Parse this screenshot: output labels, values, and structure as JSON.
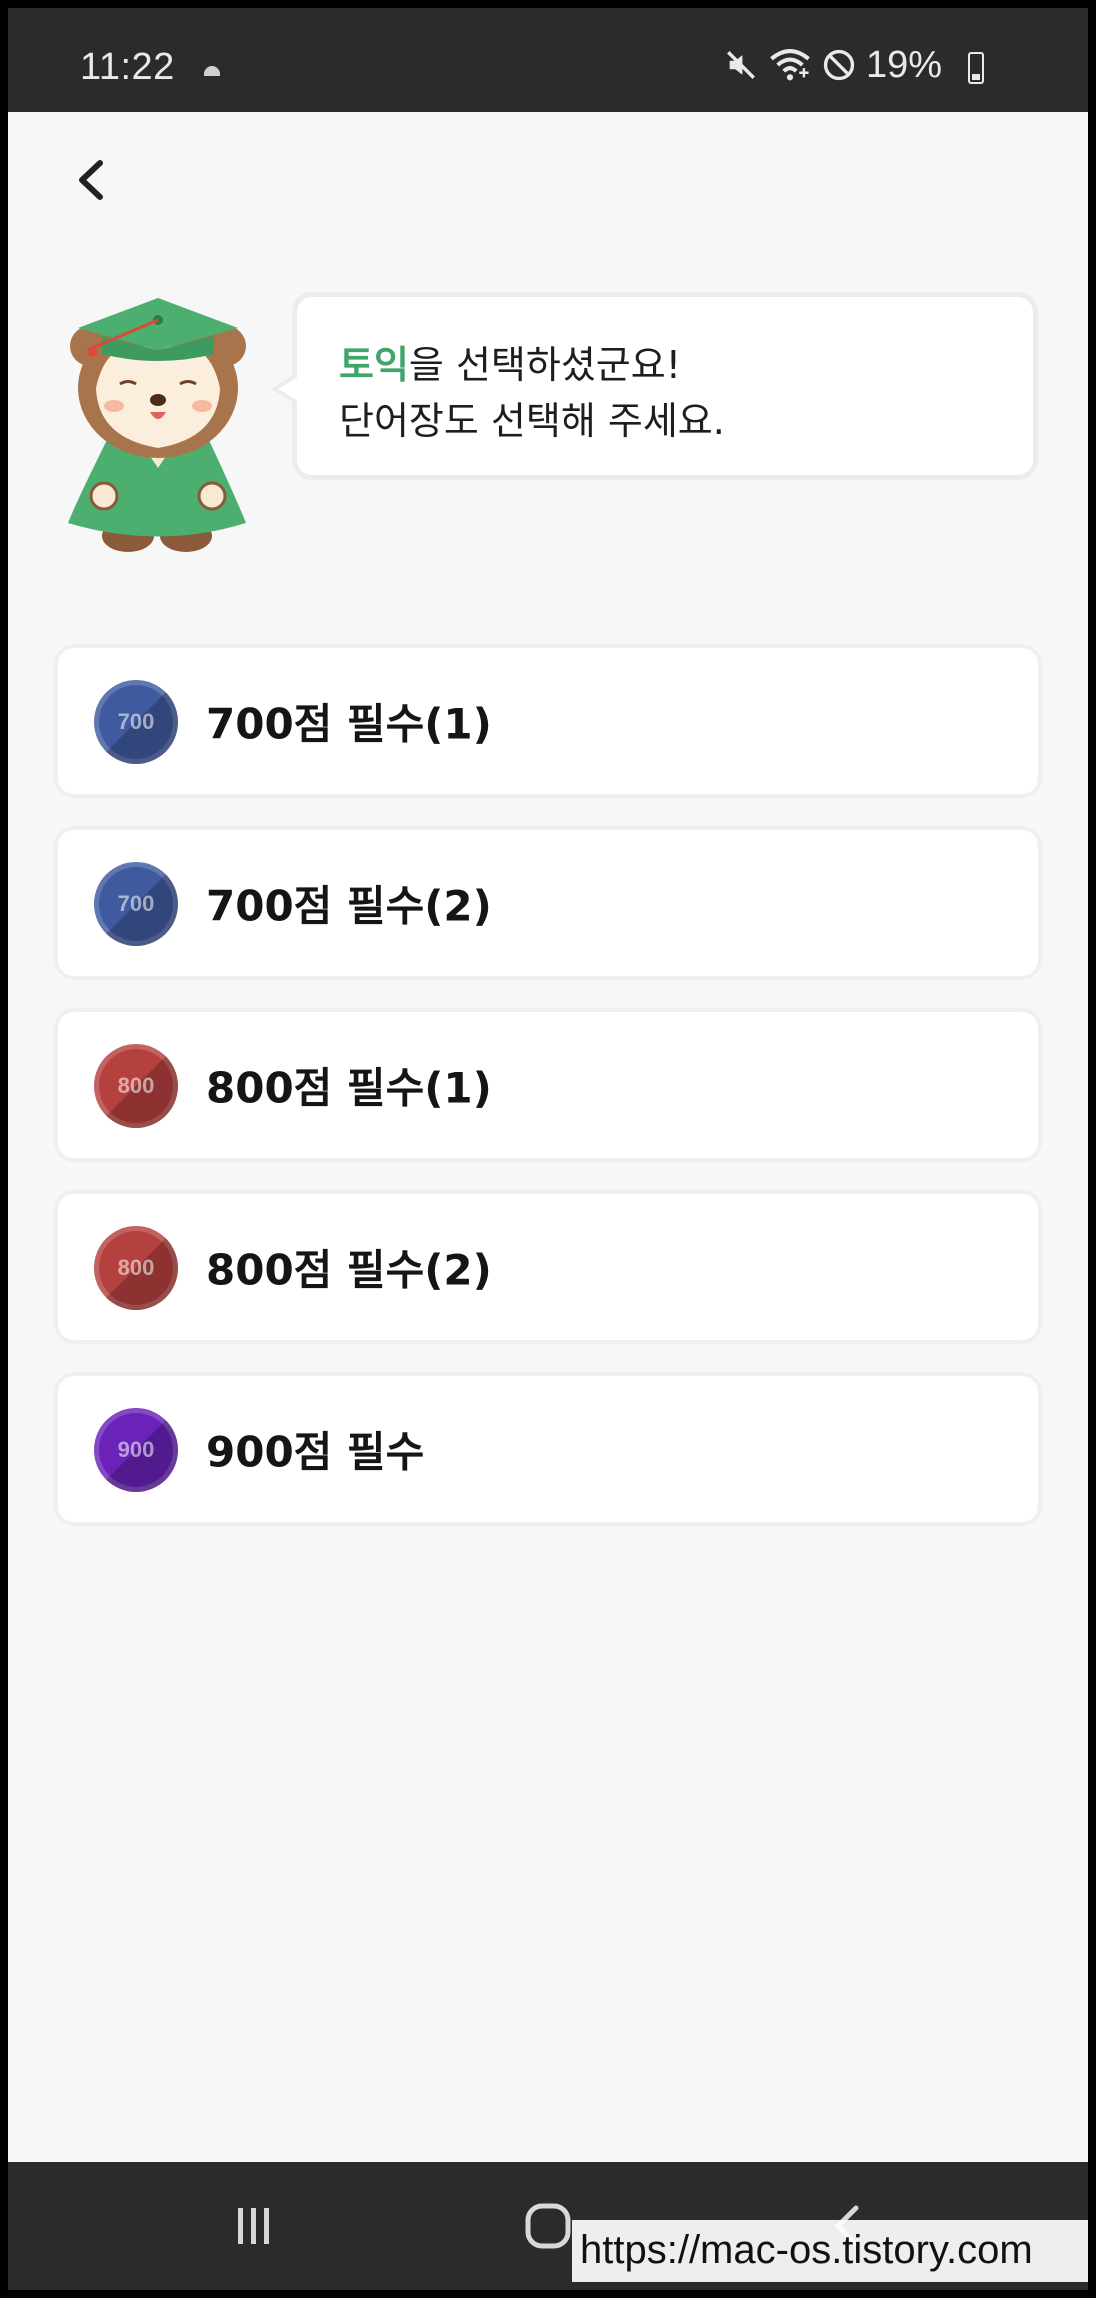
{
  "status_bar": {
    "time": "11:22",
    "battery": "19%",
    "icons": [
      "mute-icon",
      "wifi-icon",
      "do-not-disturb-icon",
      "battery-icon"
    ]
  },
  "header": {
    "back_icon": "chevron-left-icon"
  },
  "speech_bubble": {
    "highlight": "토익",
    "line1_rest": "을 선택하셨군요!",
    "line2": "단어장도 선택해 주세요.",
    "highlight_color": "#3fa56b"
  },
  "wordbooks": [
    {
      "badge": "700",
      "label": "700점 필수(1)",
      "color": "#3f5a9e"
    },
    {
      "badge": "700",
      "label": "700점 필수(2)",
      "color": "#3f5a9e"
    },
    {
      "badge": "800",
      "label": "800점 필수(1)",
      "color": "#b5413f"
    },
    {
      "badge": "800",
      "label": "800점 필수(2)",
      "color": "#b5413f"
    },
    {
      "badge": "900",
      "label": "900점 필수",
      "color": "#6a22b8"
    }
  ],
  "nav_bar": {
    "buttons": [
      "recent-apps-icon",
      "home-icon",
      "back-icon"
    ]
  },
  "watermark": "https://mac-os.tistory.com"
}
